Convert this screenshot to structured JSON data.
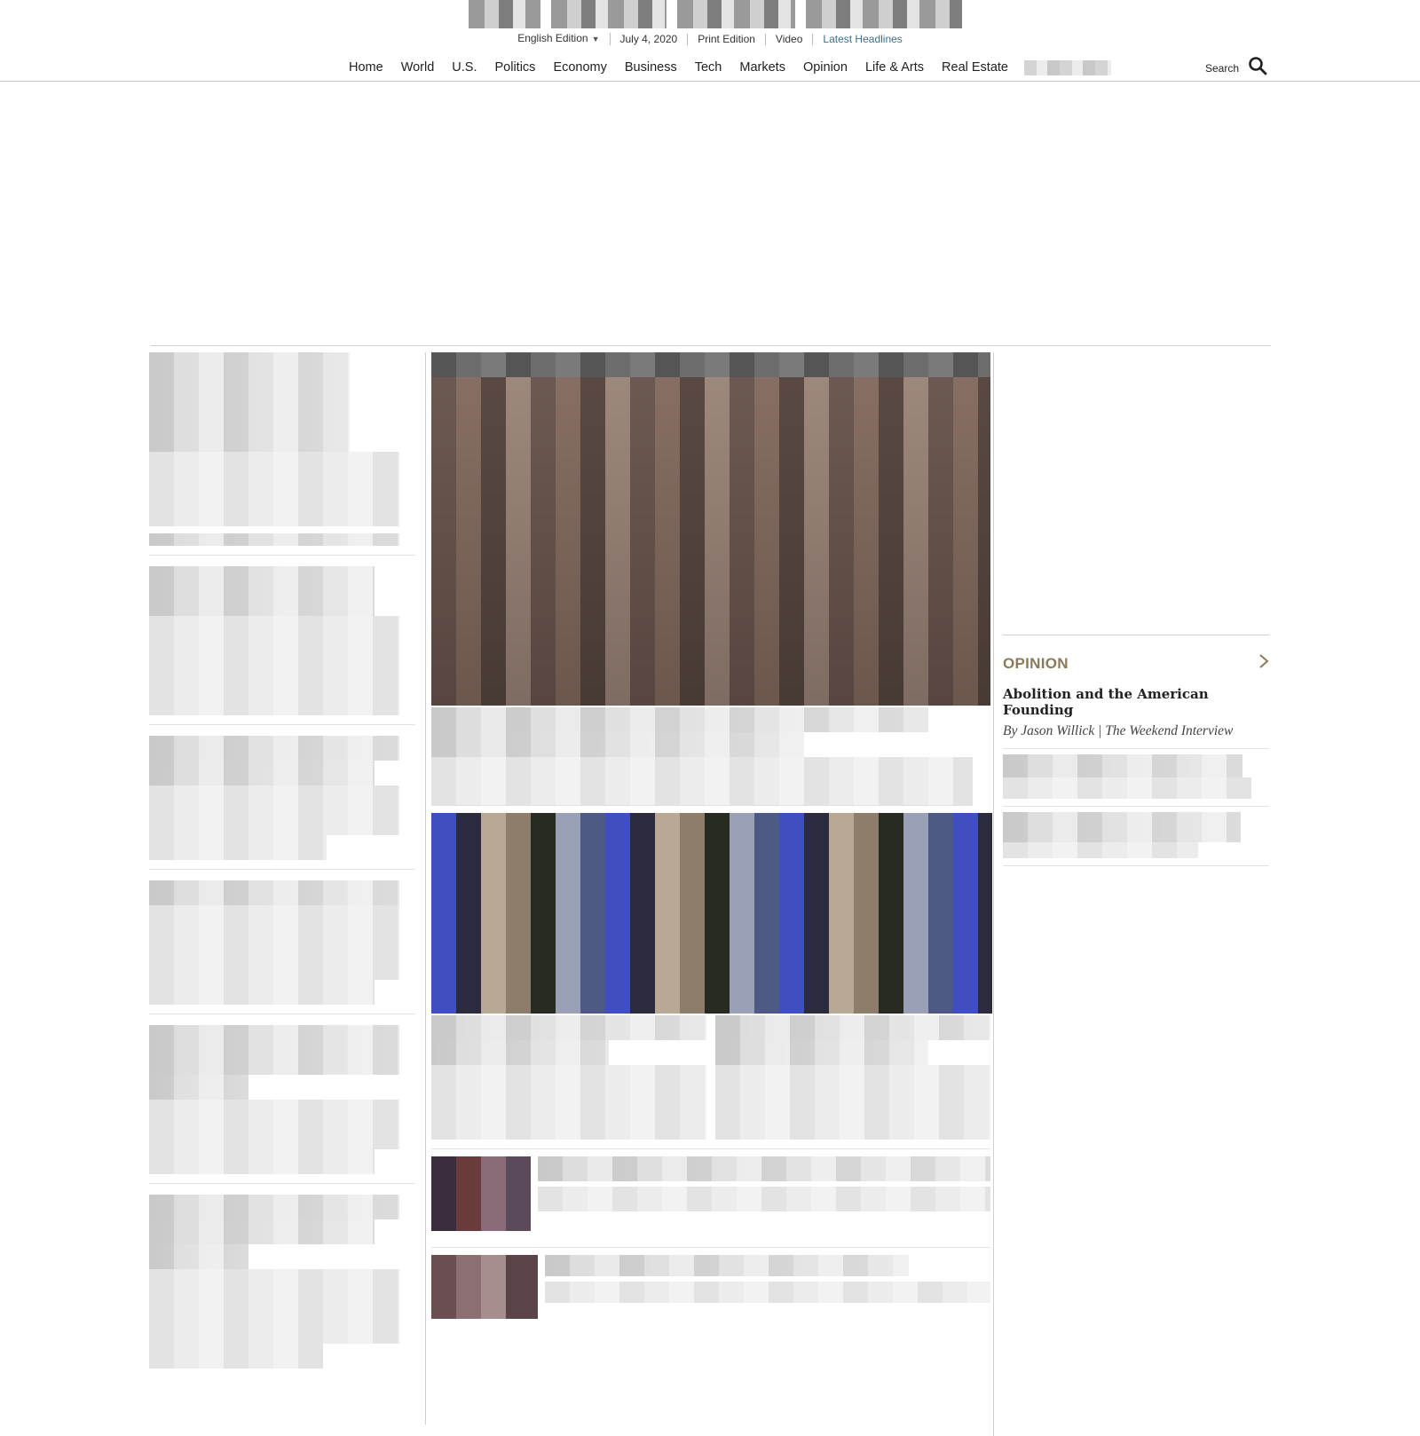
{
  "header": {
    "edition_label": "English Edition",
    "date": "July 4, 2020",
    "print_edition": "Print Edition",
    "video": "Video",
    "latest_headlines": "Latest Headlines"
  },
  "nav": {
    "items": [
      "Home",
      "World",
      "U.S.",
      "Politics",
      "Economy",
      "Business",
      "Tech",
      "Markets",
      "Opinion",
      "Life & Arts",
      "Real Estate"
    ],
    "search_label": "Search"
  },
  "opinion": {
    "label": "OPINION",
    "title": "Abolition and the American Founding",
    "byline": "By Jason Willick | The Weekend Interview"
  },
  "colors": {
    "accent_opinion": "#8a7a5c",
    "latest_headlines_link": "#3e6d8a",
    "rule": "#cfcfcf"
  },
  "icons": [
    "search-icon",
    "chevron-right-icon",
    "caret-down-icon"
  ]
}
